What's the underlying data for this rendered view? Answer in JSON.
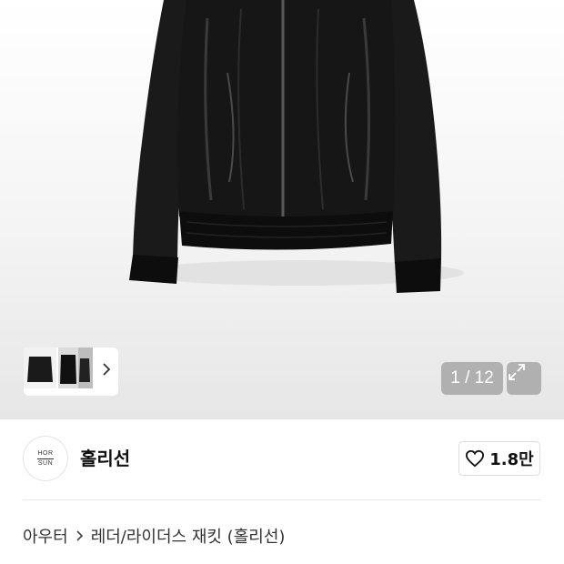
{
  "gallery": {
    "main_image_alt": "black leather bomber jacket",
    "current_page": "1",
    "page_separator": "/",
    "total_pages": "12",
    "thumbnails": [
      "jacket-front-thumb",
      "jacket-dark-thumb",
      "jacket-partial-thumb"
    ],
    "expand_icon": "expand-icon",
    "next_icon": "chevron-right-icon"
  },
  "brand": {
    "logo_line1": "HOR",
    "logo_line2": "SUN",
    "name": "홀리선",
    "like_icon": "heart-icon",
    "like_count": "1.8만"
  },
  "breadcrumb": {
    "category": "아우터",
    "separator_icon": "chevron-right-icon",
    "subcategory": "레더/라이더스 재킷 (홀리선)"
  },
  "colors": {
    "jacket": "#141414",
    "overlay": "#828282",
    "border": "#dcdcdc"
  }
}
